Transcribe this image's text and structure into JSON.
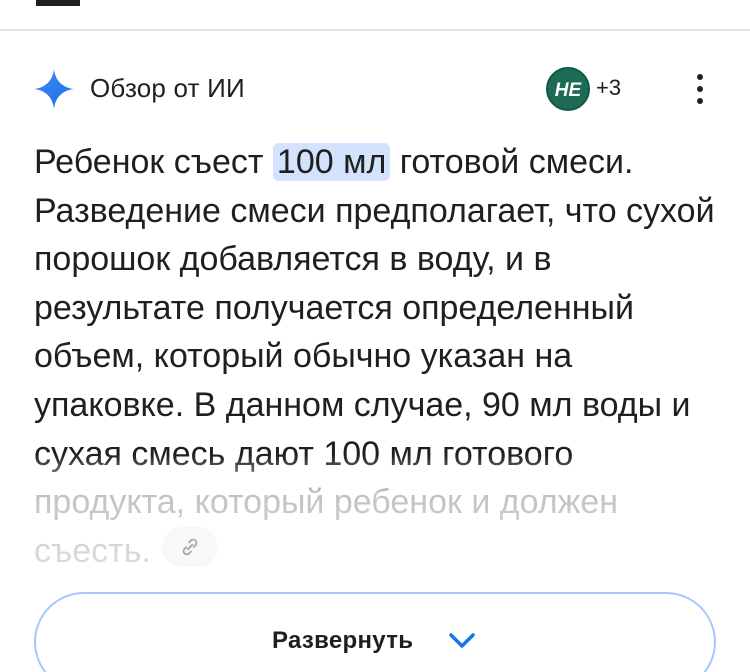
{
  "ai_overview": {
    "title": "Обзор от ИИ",
    "icon": "sparkle-icon",
    "sources": {
      "count_label": "+3",
      "avatar_text": "HE",
      "avatar_color": "#1e6b55"
    },
    "menu_icon": "more-vert-icon",
    "answer": {
      "before_highlight": "Ребенок съест ",
      "highlight": "100 мл",
      "after_highlight": " готовой смеси. Разведение смеси предполагает, что сухой порошок добавляется в воду, и в результате получается определенный объем, который обычно указан на упаковке. В данном случае, 90 мл воды и сухая смесь дают 100 мл готового продукта, который ребенок и должен съесть.",
      "link_icon": "link-icon"
    },
    "expand": {
      "label": "Развернуть",
      "icon": "chevron-down-icon"
    }
  },
  "colors": {
    "accent": "#1a73e8",
    "highlight_bg": "#d3e3fd",
    "expand_border": "#a8c7fa",
    "text": "#1f1f1f"
  }
}
